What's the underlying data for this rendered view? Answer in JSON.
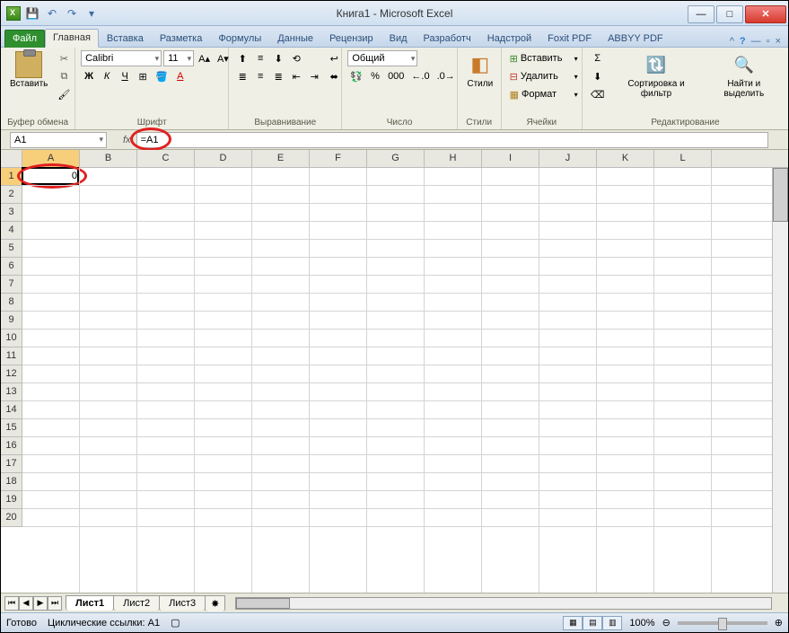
{
  "title": "Книга1  -  Microsoft Excel",
  "qat": {
    "save": "💾",
    "undo": "↶",
    "redo": "↷"
  },
  "tabs": {
    "file": "Файл",
    "items": [
      "Главная",
      "Вставка",
      "Разметка",
      "Формулы",
      "Данные",
      "Рецензир",
      "Вид",
      "Разработч",
      "Надстрой",
      "Foxit PDF",
      "ABBYY PDF"
    ],
    "active_index": 0
  },
  "ribbon": {
    "clipboard": {
      "paste": "Вставить",
      "label": "Буфер обмена"
    },
    "font": {
      "name": "Calibri",
      "size": "11",
      "label": "Шрифт",
      "bold": "Ж",
      "italic": "К",
      "underline": "Ч",
      "border": "⊞",
      "fill": "🪣",
      "color": "A"
    },
    "alignment": {
      "label": "Выравнивание",
      "wrap": "↩",
      "merge": "⬌"
    },
    "number": {
      "format": "Общий",
      "label": "Число",
      "currency": "💱",
      "percent": "%",
      "comma": "000",
      "inc": "←.0",
      "dec": ".0→"
    },
    "styles": {
      "label": "Стили",
      "btn": "Стили"
    },
    "cells": {
      "insert": "Вставить",
      "delete": "Удалить",
      "format": "Формат",
      "label": "Ячейки"
    },
    "editing": {
      "sum": "Σ",
      "fill": "⬇",
      "clear": "⌫",
      "sort": "Сортировка\nи фильтр",
      "find": "Найти и\nвыделить",
      "label": "Редактирование"
    }
  },
  "namebox": "A1",
  "formula": "=A1",
  "columns": [
    "A",
    "B",
    "C",
    "D",
    "E",
    "F",
    "G",
    "H",
    "I",
    "J",
    "K",
    "L"
  ],
  "rows": [
    "1",
    "2",
    "3",
    "4",
    "5",
    "6",
    "7",
    "8",
    "9",
    "10",
    "11",
    "12",
    "13",
    "14",
    "15",
    "16",
    "17",
    "18",
    "19",
    "20"
  ],
  "cells": {
    "A1": "0"
  },
  "sheets": {
    "items": [
      "Лист1",
      "Лист2",
      "Лист3"
    ],
    "active_index": 0
  },
  "status": {
    "ready": "Готово",
    "circular": "Циклические ссылки: A1",
    "zoom": "100%"
  }
}
